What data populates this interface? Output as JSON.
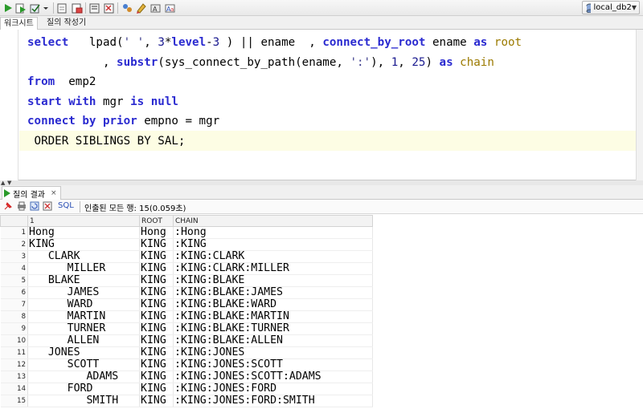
{
  "toolbar": {
    "icons": [
      "run-statement-icon",
      "run-script-icon",
      "commit-icon",
      "dropdown-icon",
      "rollback-icon",
      "autotrace-icon",
      "explain-icon",
      "sql-tuning-icon",
      "clear-icon",
      "sql-history-icon",
      "find-icon",
      "format-icon"
    ],
    "connection": "local_db2"
  },
  "editor_tabs": [
    "워크시트",
    "질의 작성기"
  ],
  "editor": {
    "lines": [
      [
        [
          "kw",
          "select"
        ],
        [
          "id",
          "   lpad("
        ],
        [
          "str",
          "' '"
        ],
        [
          "id",
          ", "
        ],
        [
          "num",
          "3"
        ],
        [
          "id",
          "*"
        ],
        [
          "kw",
          "level"
        ],
        [
          "id",
          "-"
        ],
        [
          "num",
          "3"
        ],
        [
          "id",
          " ) || ename  , "
        ],
        [
          "kw",
          "connect_by_root"
        ],
        [
          "id",
          " ename "
        ],
        [
          "kw",
          "as"
        ],
        [
          "alias",
          " root"
        ]
      ],
      [
        [
          "id",
          "           , "
        ],
        [
          "kw",
          "substr"
        ],
        [
          "id",
          "(sys_connect_by_path(ename, "
        ],
        [
          "str",
          "':'"
        ],
        [
          "id",
          "), "
        ],
        [
          "num",
          "1"
        ],
        [
          "id",
          ", "
        ],
        [
          "num",
          "25"
        ],
        [
          "id",
          ") "
        ],
        [
          "kw",
          "as"
        ],
        [
          "alias",
          " chain"
        ]
      ],
      [
        [
          "kw",
          "from"
        ],
        [
          "id",
          "  emp2"
        ]
      ],
      [
        [
          "kw",
          "start with"
        ],
        [
          "id",
          " mgr "
        ],
        [
          "kw",
          "is null"
        ]
      ],
      [
        [
          "kw",
          "connect by prior"
        ],
        [
          "id",
          " empno = mgr"
        ]
      ],
      [
        [
          "id",
          " ORDER SIBLINGS BY SAL;"
        ]
      ]
    ]
  },
  "result_tab": {
    "label": "질의 결과",
    "close": "×"
  },
  "result_toolbar": {
    "sql_label": "SQL",
    "status": "인출된 모든 행: 15(0.059초)"
  },
  "grid": {
    "columns": [
      "1",
      "ROOT",
      "CHAIN"
    ],
    "rows": [
      [
        "Hong",
        "Hong",
        ":Hong"
      ],
      [
        "KING",
        "KING",
        ":KING"
      ],
      [
        "   CLARK",
        "KING",
        ":KING:CLARK"
      ],
      [
        "      MILLER",
        "KING",
        ":KING:CLARK:MILLER"
      ],
      [
        "   BLAKE",
        "KING",
        ":KING:BLAKE"
      ],
      [
        "      JAMES",
        "KING",
        ":KING:BLAKE:JAMES"
      ],
      [
        "      WARD",
        "KING",
        ":KING:BLAKE:WARD"
      ],
      [
        "      MARTIN",
        "KING",
        ":KING:BLAKE:MARTIN"
      ],
      [
        "      TURNER",
        "KING",
        ":KING:BLAKE:TURNER"
      ],
      [
        "      ALLEN",
        "KING",
        ":KING:BLAKE:ALLEN"
      ],
      [
        "   JONES",
        "KING",
        ":KING:JONES"
      ],
      [
        "      SCOTT",
        "KING",
        ":KING:JONES:SCOTT"
      ],
      [
        "         ADAMS",
        "KING",
        ":KING:JONES:SCOTT:ADAMS"
      ],
      [
        "      FORD",
        "KING",
        ":KING:JONES:FORD"
      ],
      [
        "         SMITH",
        "KING",
        ":KING:JONES:FORD:SMITH"
      ]
    ]
  }
}
